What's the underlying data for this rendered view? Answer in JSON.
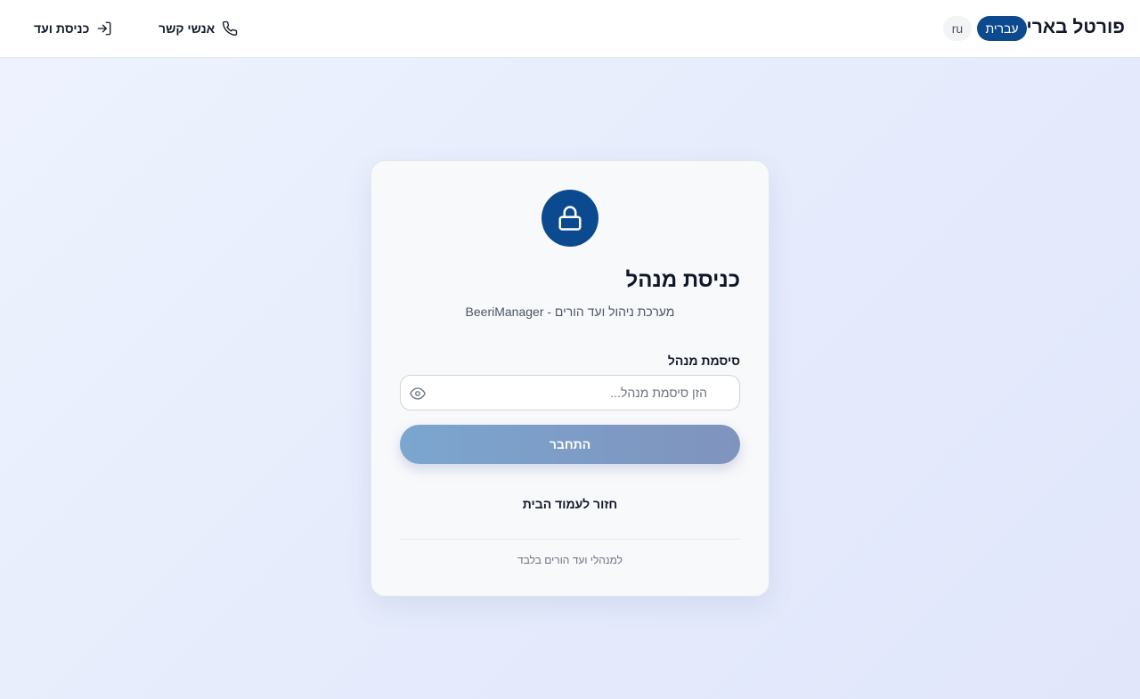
{
  "header": {
    "brand": "פורטל בארי",
    "languages": [
      {
        "label": "עברית",
        "active": true
      },
      {
        "label": "ru",
        "active": false
      }
    ],
    "nav": {
      "contacts": {
        "label": "אנשי קשר",
        "icon": "phone-icon"
      },
      "committee_login": {
        "label": "כניסת ועד",
        "icon": "login-icon"
      }
    }
  },
  "card": {
    "icon": "lock-icon",
    "title": "כניסת מנהל",
    "subtitle": "מערכת ניהול ועד הורים - BeeriManager",
    "password_field": {
      "label": "סיסמת מנהל",
      "value": "",
      "placeholder": "הזן סיסמת מנהל...",
      "toggle_icon": "eye-icon"
    },
    "submit_label": "התחבר",
    "back_link": "חזור לעמוד הבית",
    "footnote": "למנהלי ועד הורים בלבד"
  },
  "colors": {
    "brand_blue": "#0c4a8f",
    "button_gradient_start": "#7ba6cf",
    "button_gradient_end": "#7f93bd"
  }
}
